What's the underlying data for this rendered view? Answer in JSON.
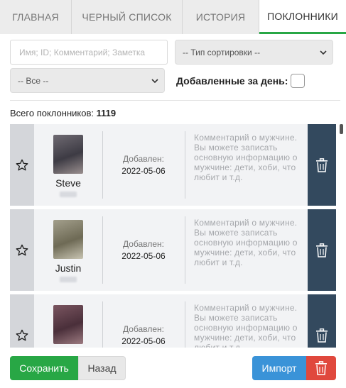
{
  "tabs": [
    {
      "label": "ГЛАВНАЯ",
      "active": false
    },
    {
      "label": "ЧЕРНЫЙ СПИСОК",
      "active": false
    },
    {
      "label": "ИСТОРИЯ",
      "active": false
    },
    {
      "label": "ПОКЛОННИКИ",
      "active": true
    }
  ],
  "filters": {
    "search_placeholder": "Имя; ID; Комментарий; Заметка",
    "sort_value": "-- Тип сортировки --",
    "type_value": "-- Все --",
    "added_today_label": "Добавленные за день:"
  },
  "summary": {
    "total_label": "Всего поклонников:",
    "total_value": "1119"
  },
  "admirers": [
    {
      "name": "Steve",
      "added_label": "Добавлен:",
      "added_date": "2022-05-06",
      "comment_placeholder": "Комментарий о мужчине. Вы можете записать основную информацию о мужчине: дети, хоби, что любит и т.д.",
      "photo_colors": [
        "#6f6a72",
        "#3d3b44",
        "#9a8f8f"
      ]
    },
    {
      "name": "Justin",
      "added_label": "Добавлен:",
      "added_date": "2022-05-06",
      "comment_placeholder": "Комментарий о мужчине. Вы можете записать основную информацию о мужчине: дети, хоби, что любит и т.д.",
      "photo_colors": [
        "#a39f8c",
        "#6e6a55",
        "#c8c4b2"
      ]
    },
    {
      "name": "",
      "added_label": "Добавлен:",
      "added_date": "2022-05-06",
      "comment_placeholder": "Комментарий о мужчине. Вы можете записать основную информацию о мужчине: дети, хоби, что любит и т.д.",
      "photo_colors": [
        "#7a5560",
        "#4a2f3a",
        "#9c7a80"
      ]
    }
  ],
  "buttons": {
    "save": "Сохранить",
    "back": "Назад",
    "import": "Импорт"
  },
  "colors": {
    "accent_green": "#28a745",
    "delete_column": "#33495e",
    "import_blue": "#3a93d8",
    "danger_red": "#e0483d"
  },
  "icons": {
    "favorite": "star-outline-icon",
    "delete": "trash-icon",
    "select_arrow": "chevron-down-icon"
  }
}
